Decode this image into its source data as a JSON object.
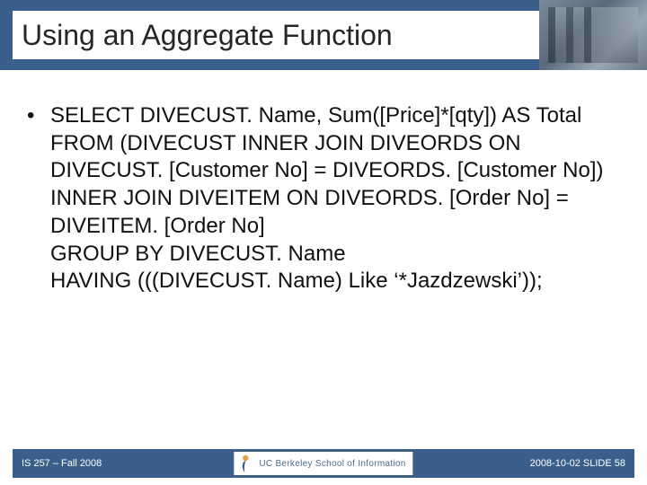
{
  "title": "Using an Aggregate Function",
  "bullet": "•",
  "sql": {
    "l1": "SELECT DIVECUST. Name, Sum([Price]*[qty]) AS Total",
    "l2": "FROM (DIVECUST INNER JOIN DIVEORDS ON DIVECUST. [Customer No] = DIVEORDS. [Customer No]) INNER JOIN DIVEITEM ON DIVEORDS. [Order No] = DIVEITEM. [Order No]",
    "l3": "GROUP BY DIVECUST. Name",
    "l4": "HAVING (((DIVECUST. Name) Like ‘*Jazdzewski’));"
  },
  "footer": {
    "left": "IS 257 – Fall 2008",
    "center": "UC Berkeley School of Information",
    "right": "2008-10-02  SLIDE 58"
  }
}
